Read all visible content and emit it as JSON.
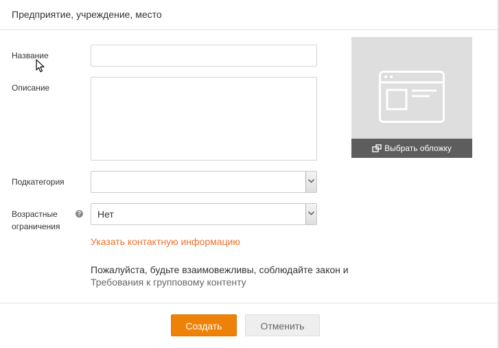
{
  "dialog": {
    "title": "Предприятие, учреждение, место"
  },
  "form": {
    "name_label": "Название",
    "name_value": "",
    "description_label": "Описание",
    "description_value": "",
    "subcategory_label": "Подкатегория",
    "subcategory_value": "",
    "age_label_line1": "Возрастные",
    "age_label_line2": "ограничения",
    "age_help_icon": "question-mark",
    "age_value": "Нет",
    "contact_link": "Указать контактную информацию"
  },
  "policy": {
    "text": "Пожалуйста, будьте взаимовежливы, соблюдайте закон и",
    "link": "Требования к групповому контенту"
  },
  "cover": {
    "button_label": "Выбрать обложку",
    "icon": "photo-upload-icon"
  },
  "footer": {
    "create_label": "Создать",
    "cancel_label": "Отменить"
  },
  "colors": {
    "accent": "#ee8208",
    "link": "#eb722e",
    "policy_link": "#666666"
  }
}
